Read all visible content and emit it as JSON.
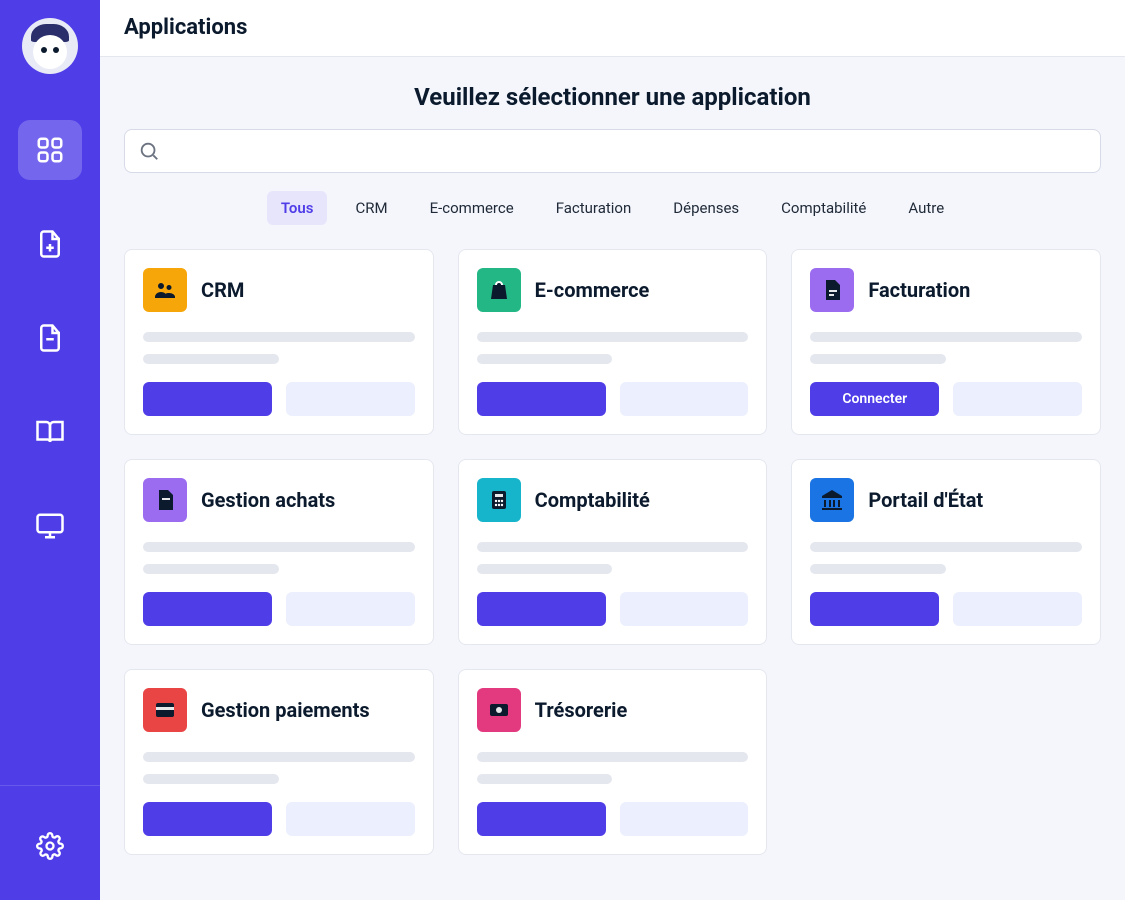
{
  "sidebar": {
    "nav_items": [
      {
        "name": "apps",
        "icon": "grid-icon",
        "active": true
      },
      {
        "name": "new-doc",
        "icon": "file-plus-icon",
        "active": false
      },
      {
        "name": "doc",
        "icon": "file-icon",
        "active": false
      },
      {
        "name": "library",
        "icon": "book-open-icon",
        "active": false
      },
      {
        "name": "desktop",
        "icon": "monitor-icon",
        "active": false
      }
    ],
    "bottom": {
      "name": "settings",
      "icon": "gear-icon"
    }
  },
  "topbar": {
    "title": "Applications"
  },
  "page": {
    "heading": "Veuillez sélectionner une application",
    "search_placeholder": ""
  },
  "tabs": [
    {
      "label": "Tous",
      "active": true
    },
    {
      "label": "CRM",
      "active": false
    },
    {
      "label": "E-commerce",
      "active": false
    },
    {
      "label": "Facturation",
      "active": false
    },
    {
      "label": "Dépenses",
      "active": false
    },
    {
      "label": "Comptabilité",
      "active": false
    },
    {
      "label": "Autre",
      "active": false
    }
  ],
  "apps": [
    {
      "slug": "crm",
      "title": "CRM",
      "icon": "users-icon",
      "color": "c-orange",
      "primary_label": "",
      "ghost_label": ""
    },
    {
      "slug": "ecommerce",
      "title": "E-commerce",
      "icon": "bag-icon",
      "color": "c-green",
      "primary_label": "",
      "ghost_label": ""
    },
    {
      "slug": "facturation",
      "title": "Facturation",
      "icon": "invoice-icon",
      "color": "c-violet",
      "primary_label": "Connecter",
      "ghost_label": ""
    },
    {
      "slug": "gestion-achats",
      "title": "Gestion achats",
      "icon": "purchase-icon",
      "color": "c-violet",
      "primary_label": "",
      "ghost_label": ""
    },
    {
      "slug": "comptabilite",
      "title": "Comptabilité",
      "icon": "calculator-icon",
      "color": "c-teal",
      "primary_label": "",
      "ghost_label": ""
    },
    {
      "slug": "portail-etat",
      "title": "Portail d'État",
      "icon": "bank-icon",
      "color": "c-blue",
      "primary_label": "",
      "ghost_label": ""
    },
    {
      "slug": "gestion-paiements",
      "title": "Gestion paiements",
      "icon": "card-icon",
      "color": "c-red",
      "primary_label": "",
      "ghost_label": ""
    },
    {
      "slug": "tresorerie",
      "title": "Trésorerie",
      "icon": "cash-icon",
      "color": "c-pink",
      "primary_label": "",
      "ghost_label": ""
    }
  ]
}
